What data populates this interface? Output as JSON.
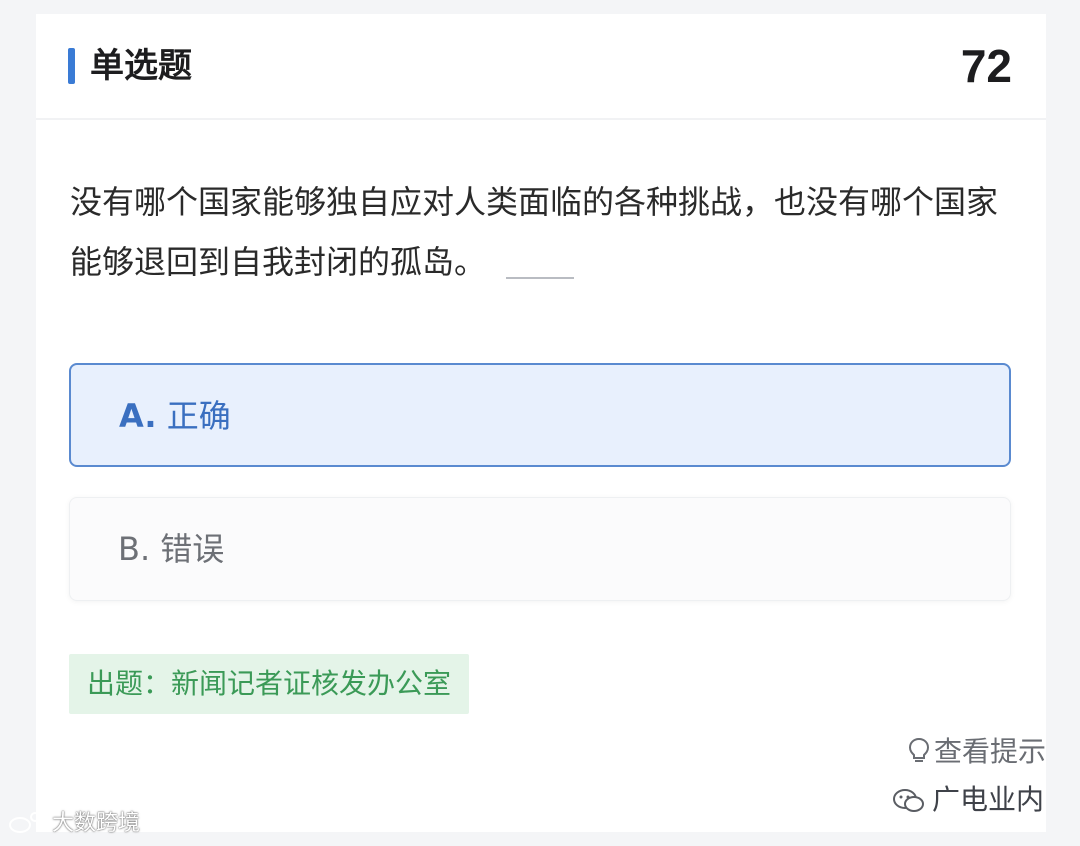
{
  "header": {
    "title": "单选题",
    "count": "72"
  },
  "question": {
    "text": "没有哪个国家能够独自应对人类面临的各种挑战，也没有哪个国家能够退回到自我封闭的孤岛。"
  },
  "options": [
    {
      "letter": "A.",
      "label": "正确",
      "selected": true
    },
    {
      "letter": "B.",
      "label": "错误",
      "selected": false
    }
  ],
  "source": {
    "text": "出题：新闻记者证核发办公室"
  },
  "hint": {
    "label": "查看提示",
    "icon": "lightbulb-icon"
  },
  "watermarks": {
    "right": "广电业内",
    "left": "大数跨境"
  },
  "colors": {
    "accent": "#3a7bd5",
    "selected_bg": "#e8f0fd",
    "source_green": "#3b9a57",
    "source_bg": "#e4f4e8"
  }
}
